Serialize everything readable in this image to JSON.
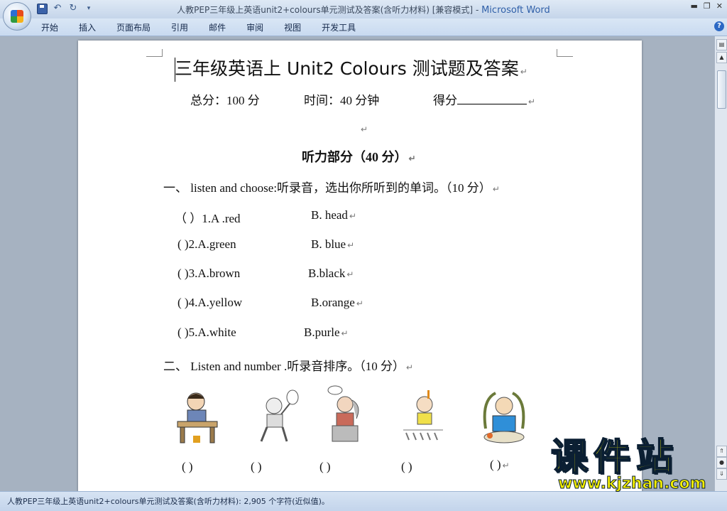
{
  "window": {
    "title_doc": "人教PEP三年级上英语unit2+colours单元测试及答案(含听力材料) [兼容模式]",
    "title_sep": " - ",
    "title_app": "Microsoft Word"
  },
  "ribbon": {
    "tabs": [
      "开始",
      "插入",
      "页面布局",
      "引用",
      "邮件",
      "审阅",
      "视图",
      "开发工具"
    ]
  },
  "document": {
    "heading": "三年级英语上 Unit2 Colours 测试题及答案",
    "total": "总分：100 分",
    "time": "时间：40 分钟",
    "score_label": "得分",
    "section_title": "听力部分（40 分）",
    "q1": "一、   listen and choose:听录音，选出你所听到的单词。（10 分）",
    "items": [
      {
        "paren": "（        ）1.A .red",
        "b": "B. head"
      },
      {
        "paren": "(        )2.A.green",
        "b": "B. blue"
      },
      {
        "paren": "(        )3.A.brown",
        "b": "B.black"
      },
      {
        "paren": "(        )4.A.yellow",
        "b": "B.orange"
      },
      {
        "paren": "(        )5.A.white",
        "b": "B.purle"
      }
    ],
    "q2": "二、   Listen and number .听录音排序。（10 分）",
    "answer_parens": [
      "(    )",
      "(        )",
      "(        )",
      "(        )",
      "(        )"
    ],
    "paragraph_mark": "↵"
  },
  "status": {
    "text": "人教PEP三年级上英语unit2+colours单元测试及答案(含听力材料): 2,905 个字符(近似值)。"
  },
  "watermark": {
    "title": "课件站",
    "url": "www.kjzhan.com"
  }
}
